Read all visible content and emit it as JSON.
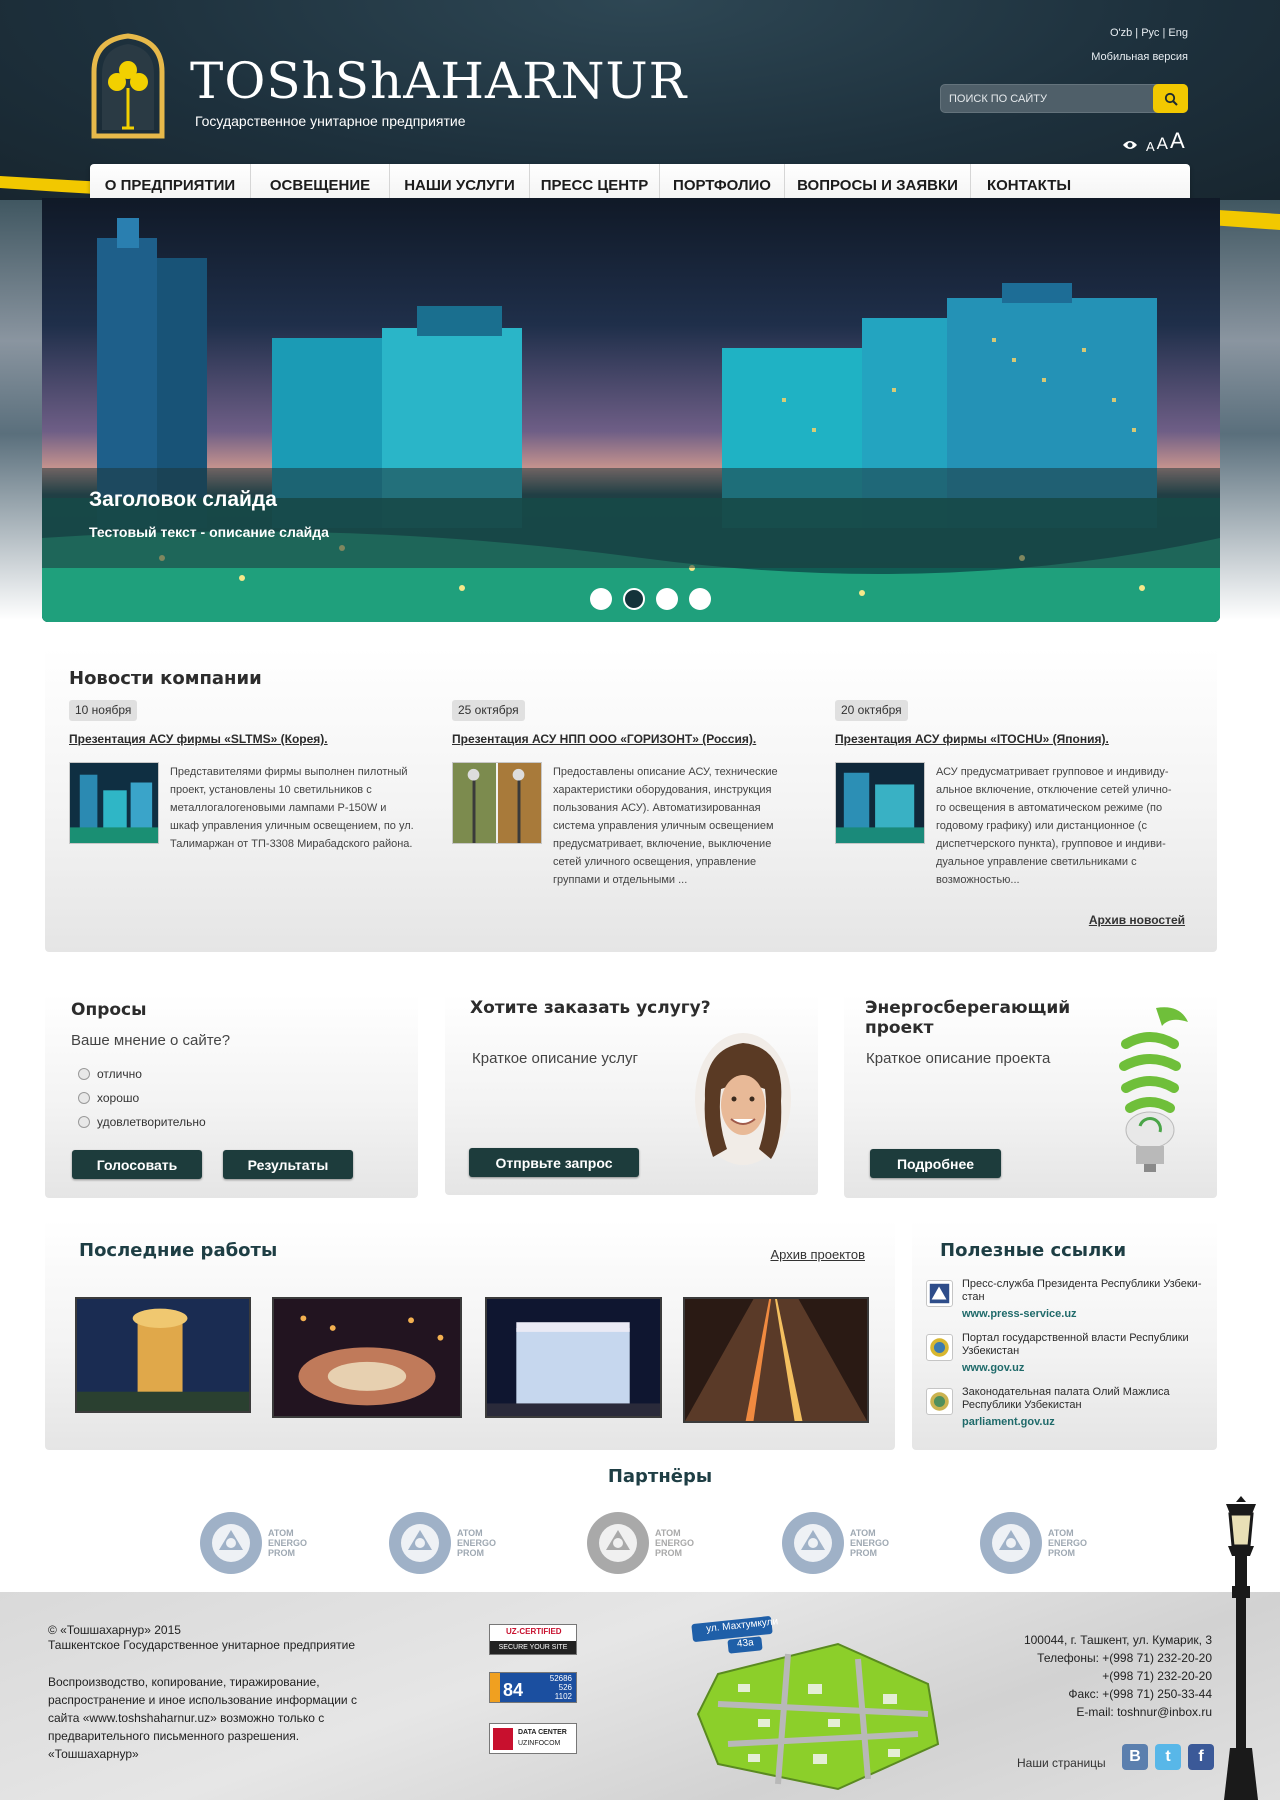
{
  "header": {
    "brand_title": "TOShShAHARNUR",
    "brand_subtitle": "Государственное унитарное предприятие",
    "languages": [
      "O'zb",
      "Рус",
      "Eng"
    ],
    "mobile_link": "Мобильная версия",
    "search_placeholder": "ПОИСК ПО САЙТУ",
    "font_sizes": [
      "A",
      "A",
      "A"
    ]
  },
  "nav": {
    "items": [
      "О ПРЕДПРИЯТИИ",
      "ОСВЕЩЕНИЕ",
      "НАШИ УСЛУГИ",
      "ПРЕСС  ЦЕНТР",
      "ПОРТФОЛИО",
      "ВОПРОСЫ И ЗАЯВКИ",
      "КОНТАКТЫ"
    ]
  },
  "slider": {
    "title": "Заголовок слайда",
    "description": "Тестовый текст - описание слайда",
    "slide_count": 4,
    "active_slide": 2
  },
  "news": {
    "title": "Новости компании",
    "items": [
      {
        "date": "10 ноября",
        "headline": "Презентация АСУ фирмы «SLTMS» (Корея).",
        "text": "Представителями фирмы выполнен пилотный проект, установлены 10 светильников с металлогалогеновыми лампами Р-150W и шкаф управления уличным освещением, по ул. Талимаржан от ТП-3308 Мирабадского района."
      },
      {
        "date": "25 октября",
        "headline": "Презентация АСУ НПП ООО «ГОРИЗОНТ» (Россия).",
        "text": "Предоставлены описание АСУ, технические характеристики оборудования, инструкция пользования АСУ). Автоматизированная система управления уличным освещением предусматривает, включение, выключение сетей уличного освещения, управление группами и отдельными ..."
      },
      {
        "date": "20 октября",
        "headline": "Презентация АСУ фирмы «ITOCHU» (Япония).",
        "text": "АСУ предусматривает групповое и индивиду-альное включение, отключение сетей улично-го освещения в автоматическом режиме (по годовому графику) или дистанционное (с диспетчерского пункта), групповое и индиви-дуальное управление светильниками с возможностью..."
      }
    ],
    "archive_link": "Архив новостей"
  },
  "poll": {
    "title": "Опросы",
    "question": "Ваше мнение о сайте?",
    "options": [
      "отлично",
      "хорошо",
      "удовлетворительно"
    ],
    "vote_button": "Голосовать",
    "results_button": "Результаты"
  },
  "order": {
    "title": "Хотите заказать услугу?",
    "description": "Краткое описание услуг",
    "button": "Отпрвьте запрос"
  },
  "energy": {
    "title": "Энергосберегающий проект",
    "description": "Краткое описание проекта",
    "button": "Подробнее"
  },
  "works": {
    "title": "Последние работы",
    "archive_link": "Архив проектов"
  },
  "links": {
    "title": "Полезные ссылки",
    "items": [
      {
        "text": "Пресс-служба Президента Республики Узбеки-стан",
        "url": "www.press-service.uz"
      },
      {
        "text": "Портал государственной власти Республики Узбекистан",
        "url": "www.gov.uz"
      },
      {
        "text": "Законодательная палата Олий Мажлиса Республики Узбекистан",
        "url": "parliament.gov.uz"
      }
    ]
  },
  "partners": {
    "title": "Партнёры",
    "logo_text": [
      "ATOM",
      "ENERGO",
      "PROM"
    ]
  },
  "footer": {
    "copyright": "© «Тошшахарнур» 2015",
    "org": "Ташкентское Государственное унитарное предприятие",
    "legal": "Воспроизводство, копирование, тиражирование, распространение и иное использование информации с сайта «www.toshshaharnur.uz» возможно только с предварительного письменного разрешения. «Тошшахарнур»",
    "badges": {
      "uzcert": "UZ-CERTIFIED",
      "uzcert_sub": "SECURE YOUR SITE",
      "counter_big": "84",
      "counter_a": "52686",
      "counter_b": "526",
      "counter_c": "1102",
      "datacenter": "DATA CENTER",
      "datacenter_sub": "UZINFOCOM"
    },
    "map_label_1": "ул. Махтумкули",
    "map_label_2": "43а",
    "address": "100044, г. Ташкент, ул. Кумарик, 3",
    "phone_1": "Телефоны: +(998 71) 232-20-20",
    "phone_2": "+(998 71) 232-20-20",
    "fax": "Факс: +(998 71) 250-33-44",
    "email": "E-mail: toshnur@inbox.ru",
    "our_pages": "Наши страницы",
    "social": [
      "В",
      "t",
      "f"
    ]
  },
  "colors": {
    "accent_yellow": "#f2c800",
    "button_dark": "#1d3c3c",
    "link_teal": "#1f6a6a"
  }
}
